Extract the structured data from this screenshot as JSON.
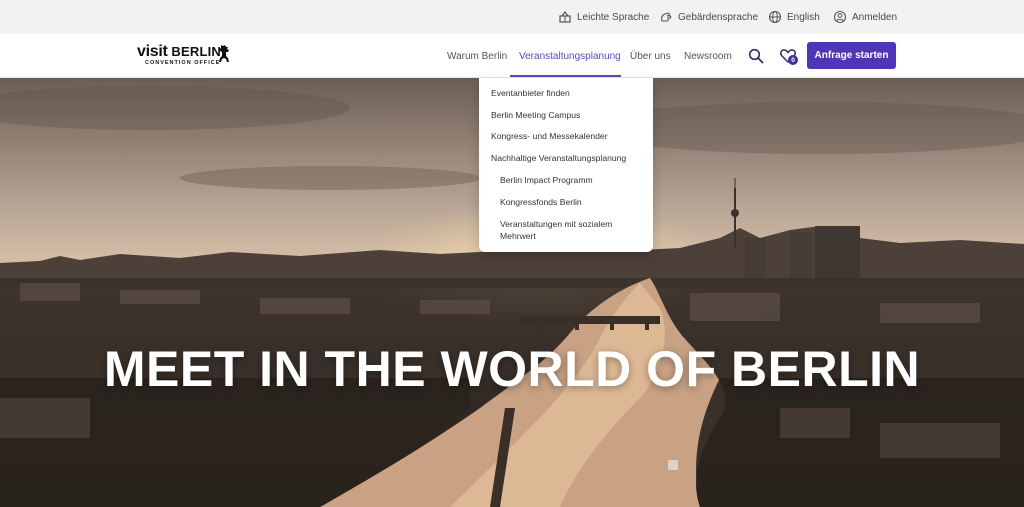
{
  "utility_bar": {
    "leichte_sprache": "Leichte Sprache",
    "gebaerdensprache": "Gebärdensprache",
    "language": "English",
    "login": "Anmelden"
  },
  "logo": {
    "brand_part1": "visit",
    "brand_part2": "BERLIN",
    "subtitle": "CONVENTION OFFICE"
  },
  "nav": {
    "items": [
      {
        "label": "Warum Berlin"
      },
      {
        "label": "Veranstaltungsplanung"
      },
      {
        "label": "Über uns"
      },
      {
        "label": "Newsroom"
      }
    ],
    "active_index": 1
  },
  "favorites": {
    "count": "0"
  },
  "cta": {
    "label": "Anfrage starten"
  },
  "dropdown": {
    "items": [
      {
        "label": "Eventanbieter finden"
      },
      {
        "label": "Berlin Meeting Campus"
      },
      {
        "label": "Kongress- und Messekalender"
      },
      {
        "label": "Nachhaltige Veranstaltungsplanung"
      },
      {
        "label": "Berlin Impact Programm"
      },
      {
        "label": "Kongressfonds Berlin"
      },
      {
        "label": "Veranstaltungen mit sozialem"
      },
      {
        "label": "Mehrwert"
      }
    ]
  },
  "hero": {
    "title": "MEET IN THE WORLD OF BERLIN"
  },
  "colors": {
    "accent": "#4f36b8",
    "nav_active": "#5b49c4",
    "utility_bg": "#f1f2f4"
  },
  "icons": [
    "leichte-sprache-icon",
    "sign-language-icon",
    "globe-icon",
    "user-icon",
    "bear-icon",
    "search-icon",
    "heart-icon"
  ]
}
